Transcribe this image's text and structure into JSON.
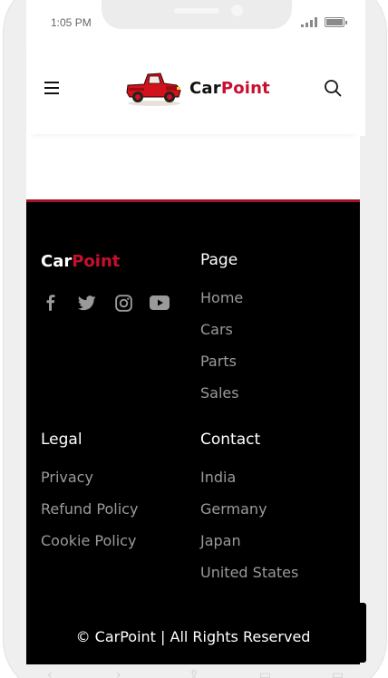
{
  "status_bar": {
    "time": "1:05 PM"
  },
  "header": {
    "brand_left": "Car",
    "brand_right": "Point",
    "menu_icon": "hamburger-menu-icon",
    "search_icon": "search-icon",
    "logo_icon": "red-truck-logo"
  },
  "footer": {
    "brand_left": "Car",
    "brand_right": "Point",
    "socials": [
      "facebook-icon",
      "twitter-icon",
      "instagram-icon",
      "youtube-icon"
    ],
    "page": {
      "title": "Page",
      "links": [
        "Home",
        "Cars",
        "Parts",
        "Sales"
      ]
    },
    "legal": {
      "title": "Legal",
      "links": [
        "Privacy",
        "Refund Policy",
        "Cookie Policy"
      ]
    },
    "contact": {
      "title": "Contact",
      "links": [
        "India",
        "Germany",
        "Japan",
        "United States"
      ]
    },
    "copyright": "© CarPoint | All Rights Reserved"
  },
  "colors": {
    "accent": "#c8102e",
    "footer_bg": "#000000",
    "link": "#9a9a9a",
    "footer_border": "#a0112b"
  }
}
